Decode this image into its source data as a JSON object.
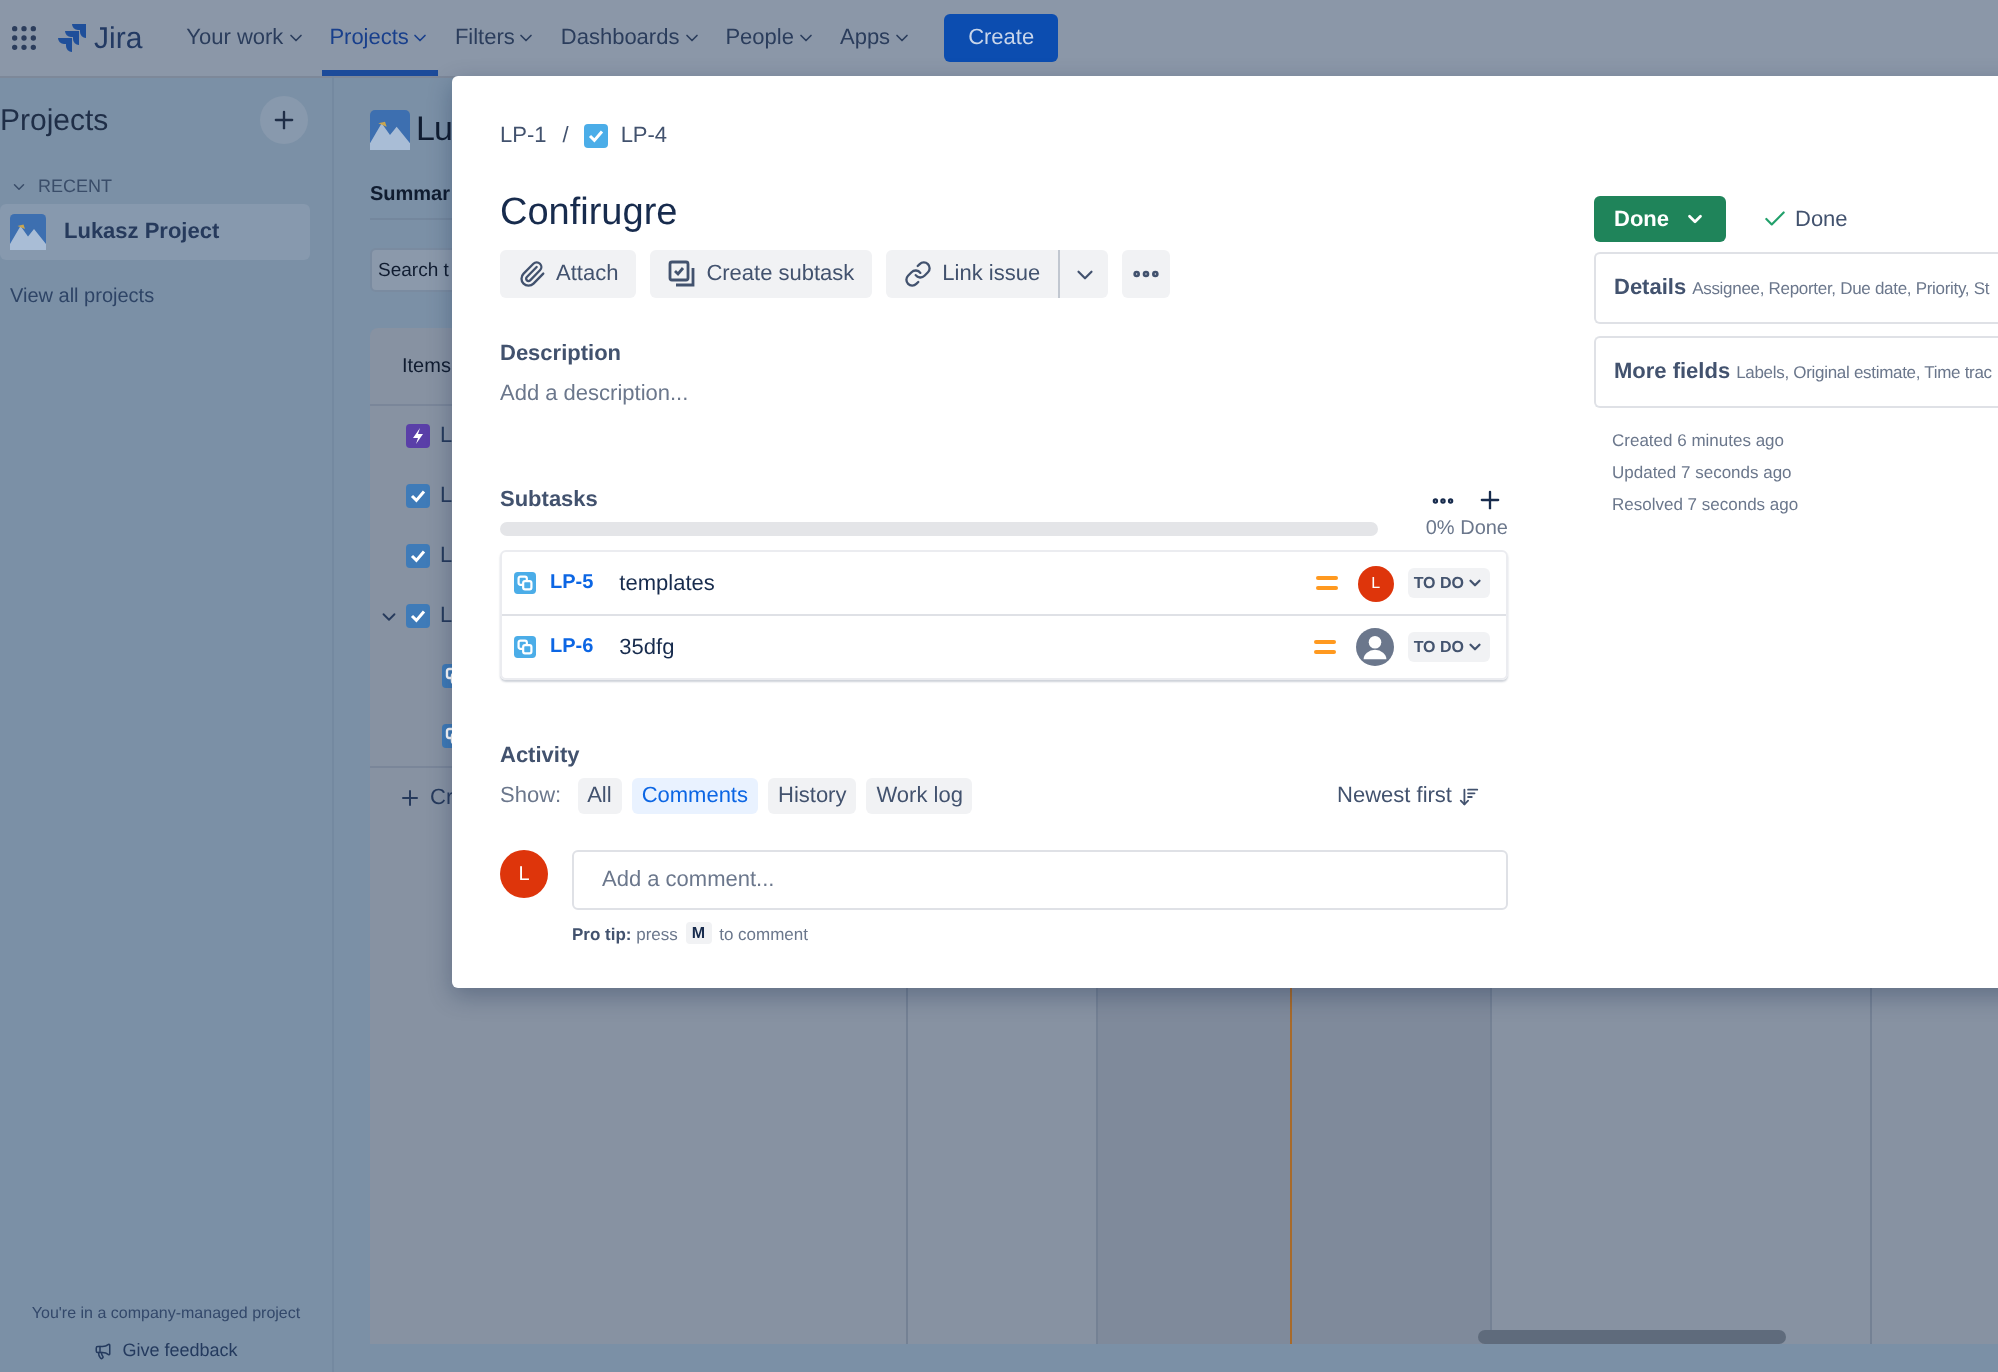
{
  "top_nav": {
    "app_name": "Jira",
    "items": [
      {
        "label": "Your work",
        "selected": false
      },
      {
        "label": "Projects",
        "selected": true
      },
      {
        "label": "Filters",
        "selected": false
      },
      {
        "label": "Dashboards",
        "selected": false
      },
      {
        "label": "People",
        "selected": false
      },
      {
        "label": "Apps",
        "selected": false
      }
    ],
    "create_button": "Create"
  },
  "sidebar": {
    "title": "Projects",
    "section": "RECENT",
    "items": [
      {
        "label": "Lukasz Project",
        "selected": true
      }
    ],
    "view_all": "View all projects",
    "footer_note": "You're in a company-managed project",
    "feedback": "Give feedback"
  },
  "project": {
    "title": "Lu",
    "tab": "Summar",
    "search_placeholder": "Search t",
    "table_header": "Items",
    "rows": [
      {
        "key": "L",
        "kind": "epic",
        "expanded": false
      },
      {
        "key": "L",
        "kind": "task",
        "expanded": false
      },
      {
        "key": "L",
        "kind": "task",
        "expanded": false
      },
      {
        "key": "L",
        "kind": "task",
        "expanded": true
      },
      {
        "key": "",
        "kind": "subtask",
        "expanded": false
      },
      {
        "key": "",
        "kind": "subtask",
        "expanded": false
      }
    ],
    "create": "Cr"
  },
  "issue": {
    "breadcrumbs": [
      {
        "label": "LP-1",
        "kind": "parent"
      },
      {
        "label": "LP-4",
        "kind": "task"
      }
    ],
    "separator": "/",
    "title": "Confirugre",
    "actions": [
      {
        "label": "Attach",
        "kind": "attach"
      },
      {
        "label": "Create subtask",
        "kind": "subtask"
      },
      {
        "label": "Link issue",
        "kind": "link"
      }
    ],
    "description": {
      "label": "Description",
      "placeholder": "Add a description..."
    },
    "subtasks": {
      "label": "Subtasks",
      "level": 0,
      "progress_text": "0% Done",
      "items": [
        {
          "key": "LP-5",
          "summary": "templates",
          "assignee": "L",
          "status": "TO DO"
        },
        {
          "key": "LP-6",
          "summary": "35dfg",
          "status": "TO DO"
        }
      ]
    },
    "activity": {
      "label": "Activity",
      "show_label": "Show:",
      "filters": [
        {
          "label": "All",
          "selected": false
        },
        {
          "label": "Comments",
          "selected": true
        },
        {
          "label": "History",
          "selected": false
        },
        {
          "label": "Work log",
          "selected": false
        }
      ],
      "sort": "Newest first",
      "comment_avatar": "L",
      "comment_placeholder": "Add a comment...",
      "tip_prefix": "**Pro tip:** press",
      "tip_key": "M",
      "tip_suffix": "to comment"
    },
    "status_button": "Done",
    "resolution": "Done",
    "panels": [
      {
        "title": "Details",
        "fields": "Assignee, Reporter, Due date, Priority, St"
      },
      {
        "title": "More fields",
        "fields": "Labels, Original estimate, Time trac"
      }
    ],
    "dates": [
      "Created 6 minutes ago",
      "Updated 7 seconds ago",
      "Resolved 7 seconds ago"
    ]
  }
}
